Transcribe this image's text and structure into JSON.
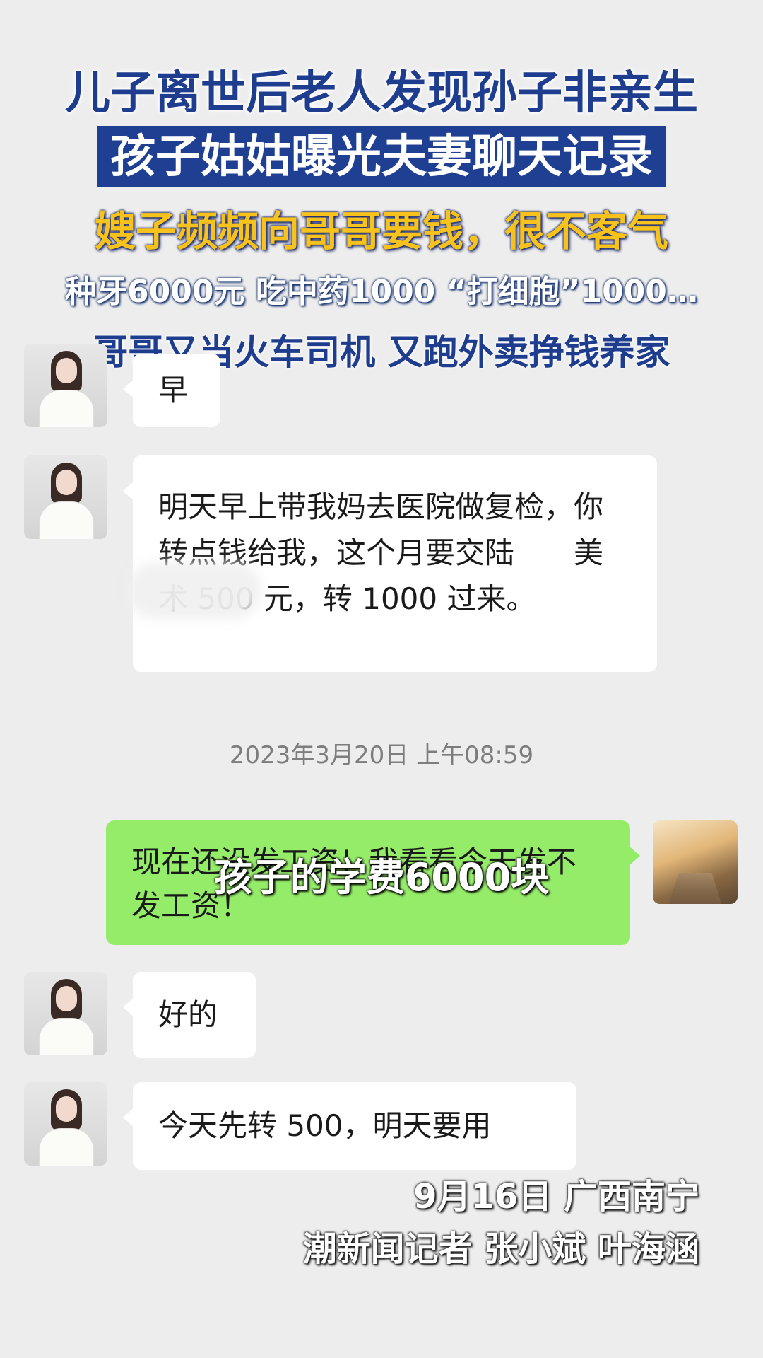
{
  "headline": {
    "line1": "儿子离世后老人发现孙子非亲生",
    "line2": "孩子姑姑曝光夫妻聊天记录",
    "line3": "嫂子频频向哥哥要钱，很不客气",
    "line4": "种牙6000元 吃中药1000 “打细胞”1000…",
    "line5": "哥哥又当火车司机 又跑外卖挣钱养家"
  },
  "chat": {
    "messages": [
      {
        "from": "other",
        "text": "早"
      },
      {
        "from": "other",
        "text": "明天早上带我妈去医院做复检，你转点钱给我，这个月要交陆　　美术 500 元，转 1000 过来。"
      },
      {
        "from": "self",
        "text": "现在还没发工资！我看看今天发不发工资！"
      },
      {
        "from": "other",
        "text": "好的"
      },
      {
        "from": "other",
        "text": "今天先转 500，明天要用"
      }
    ],
    "timestamp": "2023年3月20日 上午08:59"
  },
  "caption": "孩子的学费6000块",
  "footer": {
    "date_place": "9月16日 广西南宁",
    "reporters": "潮新闻记者 张小斌 叶海涵"
  },
  "colors": {
    "background": "#ededed",
    "bubble_other": "#ffffff",
    "bubble_self": "#95ec69",
    "headline_blue": "#1f3d8f",
    "headline_yellow": "#f6c21b"
  }
}
